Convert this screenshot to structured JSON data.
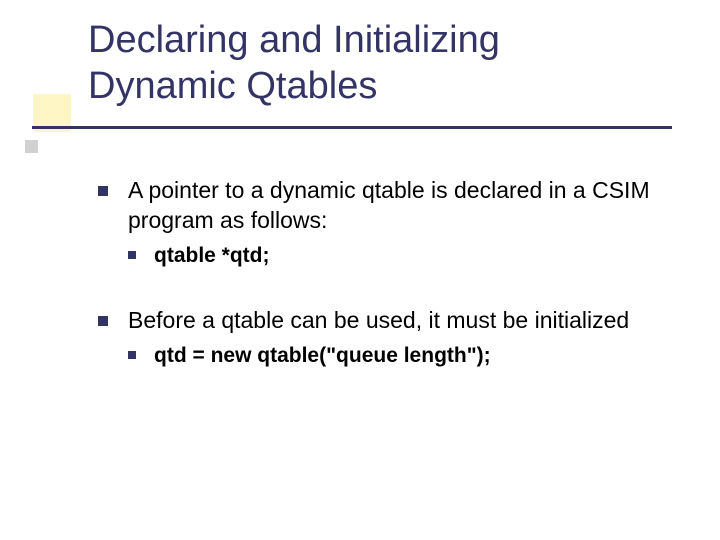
{
  "title_line1": "Declaring and Initializing",
  "title_line2": "Dynamic Qtables",
  "bullets": {
    "b1": "A pointer to a dynamic qtable is declared in a CSIM program as follows:",
    "b1_sub": "qtable *qtd;",
    "b2": "Before a qtable can be used, it must be initialized",
    "b2_sub": "qtd = new qtable(\"queue length\");"
  }
}
